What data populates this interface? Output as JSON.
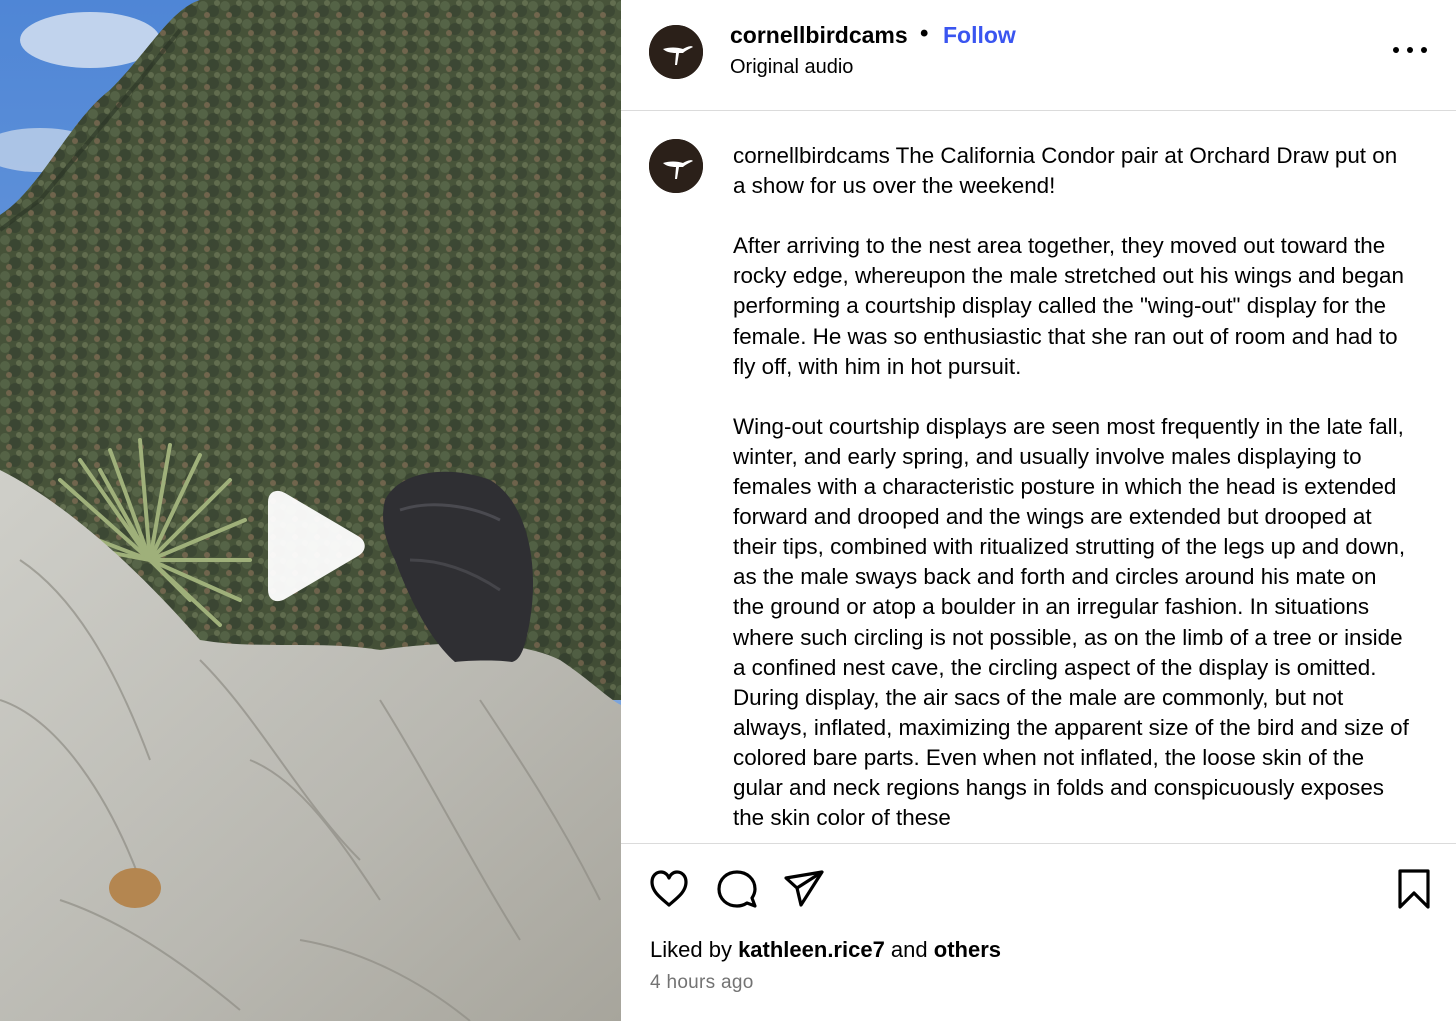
{
  "header": {
    "username": "cornellbirdcams",
    "separator": "•",
    "follow_label": "Follow",
    "audio_label": "Original audio",
    "more_icon": "more-horizontal-icon"
  },
  "caption": {
    "username": "cornellbirdcams",
    "text": " The California Condor pair at Orchard Draw put on a show for us over the weekend!\n\nAfter arriving to the nest area together, they moved out toward the rocky edge, whereupon the male stretched out his wings and began performing a courtship display called the \"wing-out\" display for the female. He was so enthusiastic that she ran out of room and had to fly off, with him in hot pursuit.\n\nWing-out courtship displays are seen most frequently in the late fall, winter, and early spring, and usually involve males displaying to females with a characteristic posture in which the head is extended forward and drooped and the wings are extended but drooped at their tips, combined with ritualized strutting of the legs up and down, as the male sways back and forth and circles around his mate on the ground or atop a boulder in an irregular fashion. In situations where such circling is not possible, as on the limb of a tree or inside a confined nest cave, the circling aspect of the display is omitted. During display, the air sacs of the male are commonly, but not always, inflated, maximizing the apparent size of the bird and size of colored bare parts. Even when not inflated, the loose skin of the gular and neck regions hangs in folds and conspicuously exposes the skin color of these"
  },
  "media": {
    "play_icon": "play-icon"
  },
  "actions": {
    "icons": [
      "heart-icon",
      "comment-icon",
      "share-icon",
      "bookmark-icon"
    ]
  },
  "likes": {
    "prefix": "Liked by ",
    "user": "kathleen.rice7",
    "middle": " and ",
    "others": "others"
  },
  "timestamp": "4 hours ago",
  "colors": {
    "follow": "#3a55f0",
    "divider": "#dbdbdb",
    "timestamp": "#737373",
    "avatar_bg": "#2b2019"
  }
}
